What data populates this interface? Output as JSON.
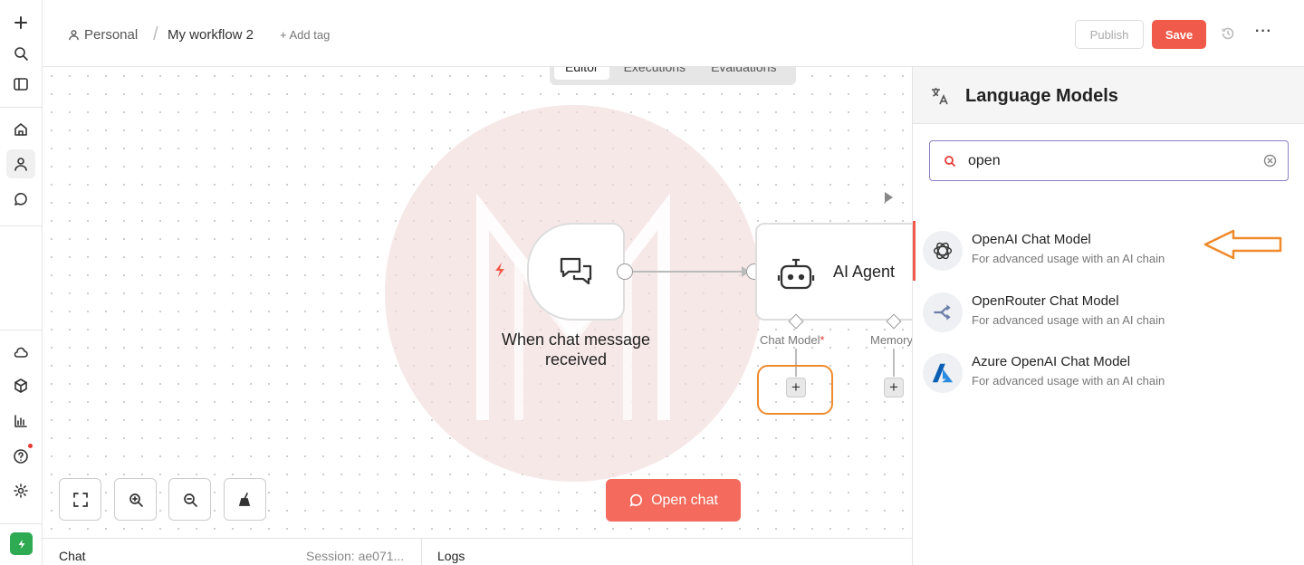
{
  "header": {
    "breadcrumb_project": "Personal",
    "workflow_name": "My workflow 2",
    "add_tag": "+ Add tag",
    "publish_label": "Publish",
    "save_label": "Save"
  },
  "tabs": [
    {
      "label": "Editor",
      "active": true
    },
    {
      "label": "Executions",
      "active": false
    },
    {
      "label": "Evaluations",
      "active": false
    }
  ],
  "nodes": {
    "trigger_title": "When chat message received",
    "agent_title": "AI Agent",
    "agent_inputs": [
      {
        "label": "Chat Model",
        "required": "*"
      },
      {
        "label": "Memory"
      }
    ]
  },
  "canvas": {
    "open_chat_label": "Open chat"
  },
  "bottom_bar": {
    "chat_label": "Chat",
    "session_label": "Session: ae071...",
    "logs_label": "Logs"
  },
  "panel": {
    "title": "Language Models",
    "search_value": "open",
    "results": [
      {
        "name": "OpenAI Chat Model",
        "description": "For advanced usage with an AI chain",
        "icon": "openai-icon"
      },
      {
        "name": "OpenRouter Chat Model",
        "description": "For advanced usage with an AI chain",
        "icon": "openrouter-icon"
      },
      {
        "name": "Azure OpenAI Chat Model",
        "description": "For advanced usage with an AI chain",
        "icon": "azure-icon"
      }
    ]
  },
  "colors": {
    "accent": "#f05a4a",
    "highlight": "#f08a2a",
    "success": "#2eaa53"
  }
}
